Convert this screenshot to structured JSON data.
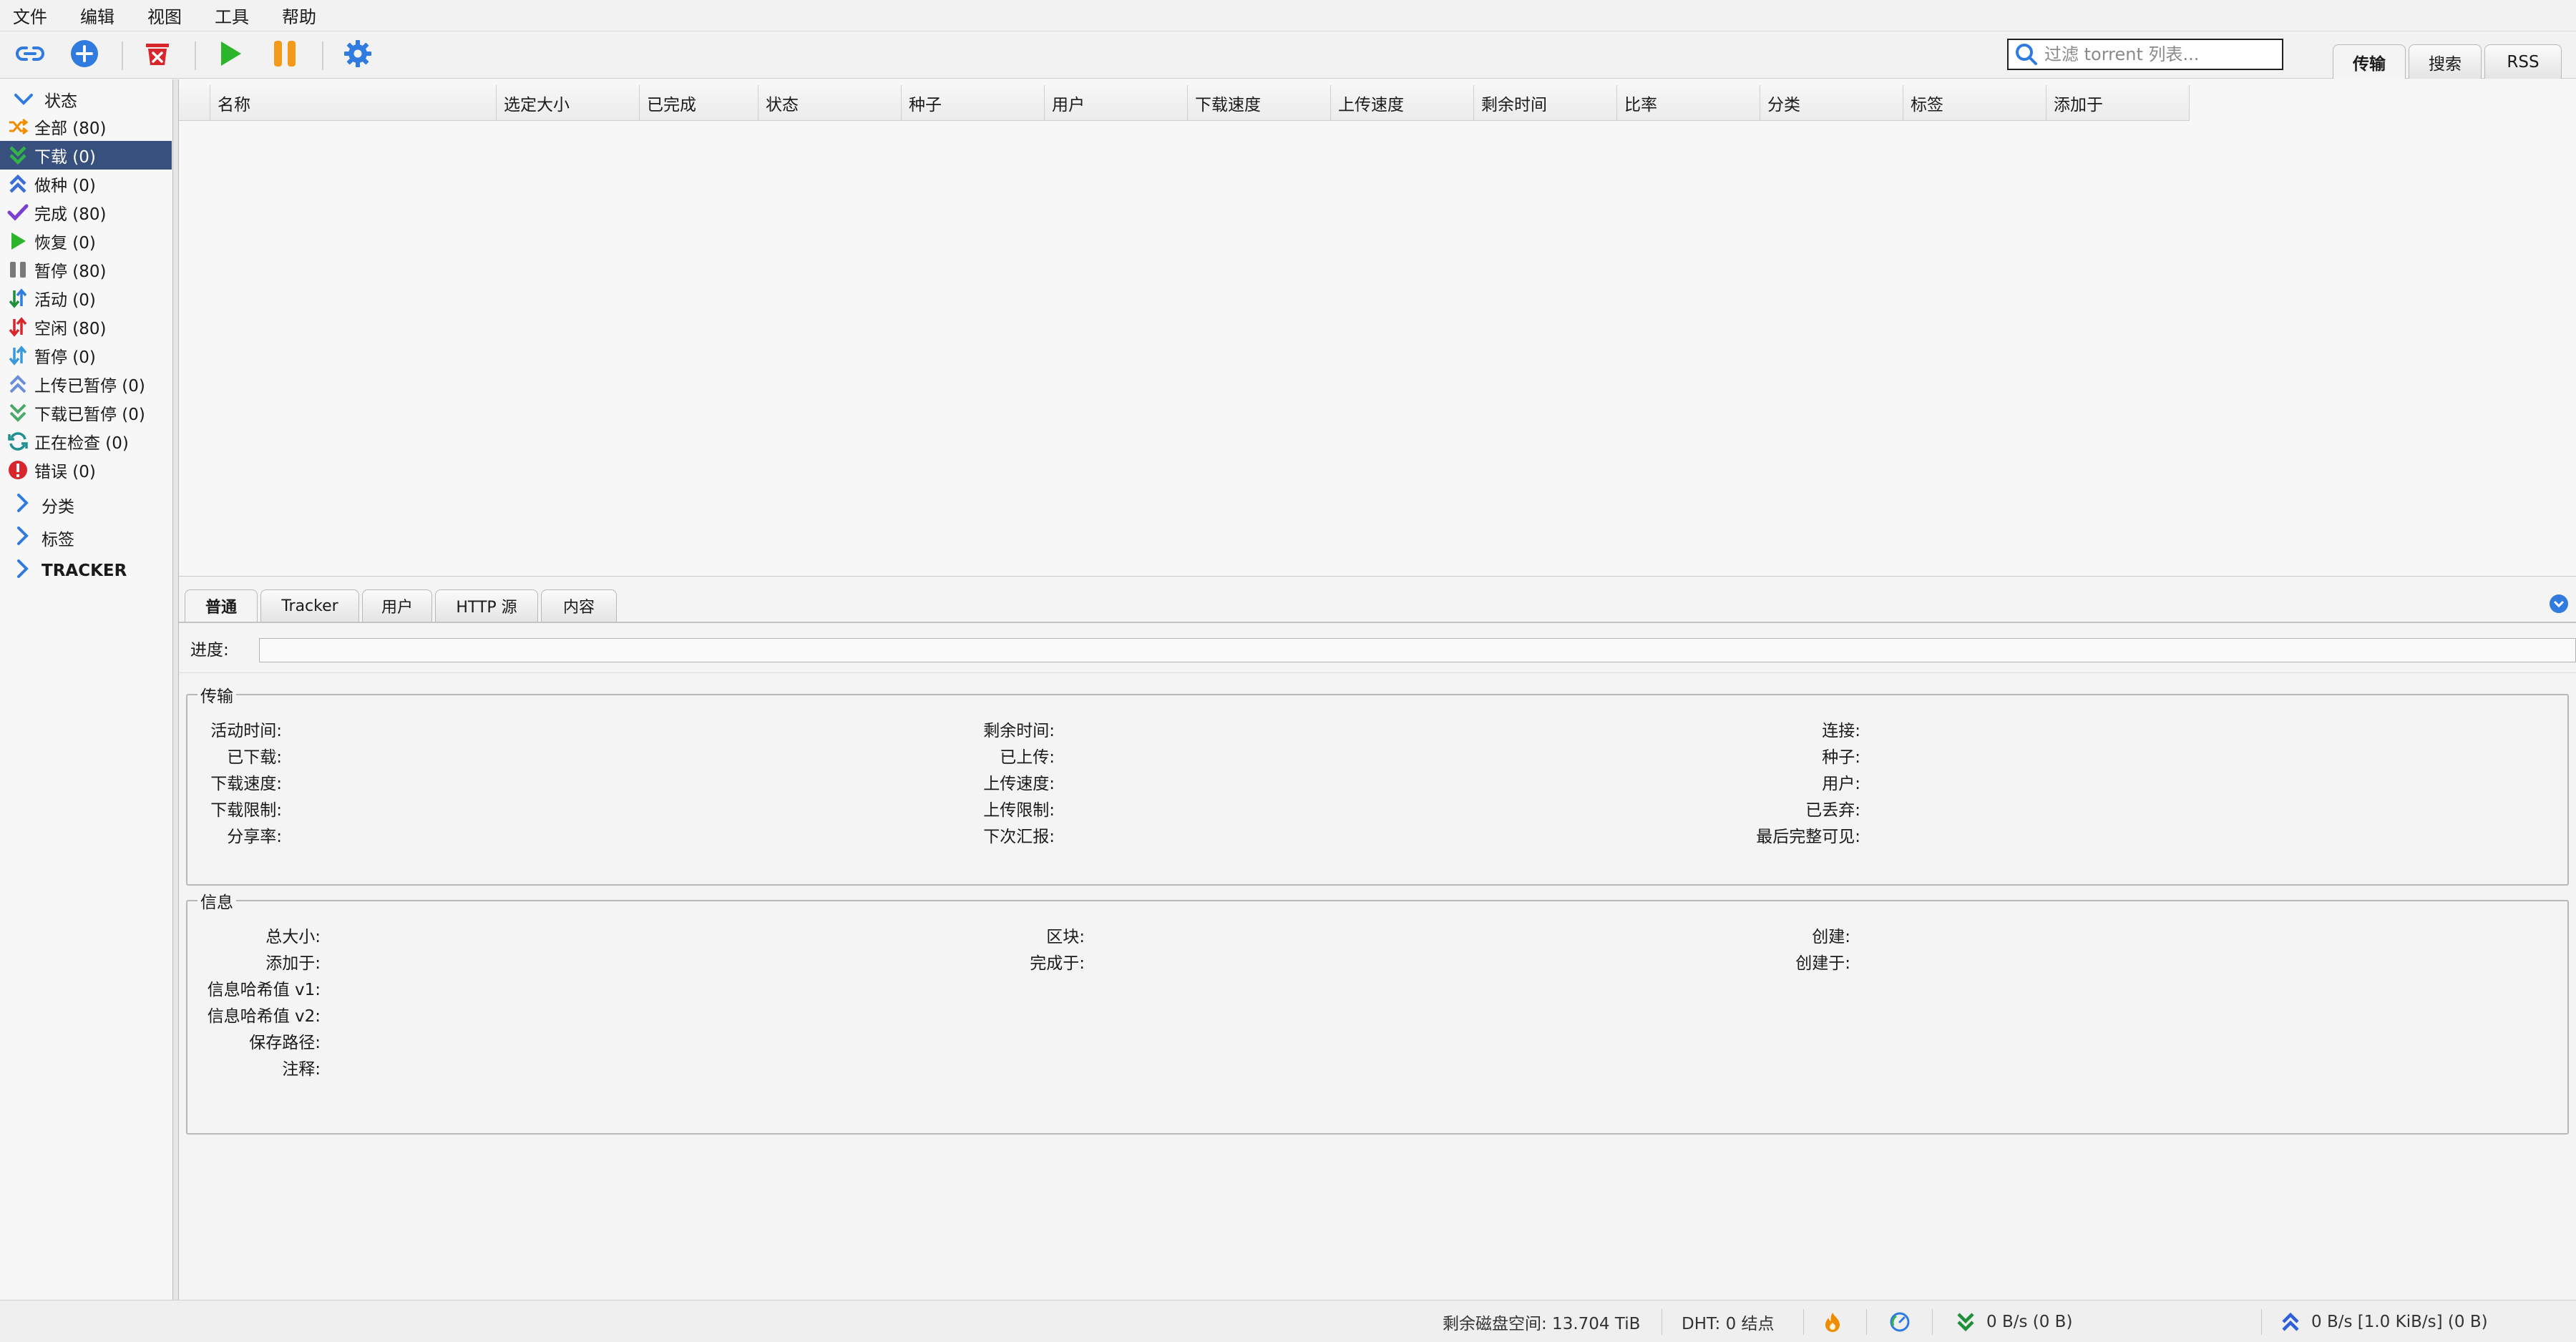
{
  "menu": [
    "文件",
    "编辑",
    "视图",
    "工具",
    "帮助"
  ],
  "toolbar": {
    "icons": [
      "add-link-icon",
      "add-torrent-icon",
      "delete-icon",
      "resume-icon",
      "pause-icon",
      "options-icon"
    ],
    "search_placeholder": "过滤 torrent 列表..."
  },
  "top_tabs": [
    "传输",
    "搜索",
    "RSS"
  ],
  "sidebar": {
    "status_header": "状态",
    "items": [
      {
        "label": "全部 (80)",
        "icon": "shuffle-icon",
        "color": "#f08c00"
      },
      {
        "label": "下载 (0)",
        "icon": "download-icon",
        "color": "#2e9e3e"
      },
      {
        "label": "做种 (0)",
        "icon": "seeding-icon",
        "color": "#3a6fd8"
      },
      {
        "label": "完成 (80)",
        "icon": "checkmark-icon",
        "color": "#7b3fd1"
      },
      {
        "label": "恢复 (0)",
        "icon": "play-icon",
        "color": "#2ab52a"
      },
      {
        "label": "暂停 (80)",
        "icon": "pause-icon",
        "color": "#7a7a7a"
      },
      {
        "label": "活动 (0)",
        "icon": "active-icon",
        "color": "#1f8f3a"
      },
      {
        "label": "空闲 (80)",
        "icon": "inactive-icon",
        "color": "#d8262c"
      },
      {
        "label": "暂停 (0)",
        "icon": "stalled-icon",
        "color": "#3a9ad9"
      },
      {
        "label": "上传已暂停 (0)",
        "icon": "stalled-upload-icon",
        "color": "#6a8fd8"
      },
      {
        "label": "下载已暂停 (0)",
        "icon": "stalled-download-icon",
        "color": "#4aa86a"
      },
      {
        "label": "正在检查 (0)",
        "icon": "checking-icon",
        "color": "#1f8f8f"
      },
      {
        "label": "错误 (0)",
        "icon": "error-icon",
        "color": "#d8262c"
      }
    ],
    "groups": [
      "分类",
      "标签",
      "TRACKER"
    ]
  },
  "columns": [
    "名称",
    "选定大小",
    "已完成",
    "状态",
    "种子",
    "用户",
    "下载速度",
    "上传速度",
    "剩余时间",
    "比率",
    "分类",
    "标签",
    "添加于"
  ],
  "props": {
    "tabs": [
      "普通",
      "Tracker",
      "用户",
      "HTTP 源",
      "内容"
    ],
    "progress_label": "进度:",
    "progress": 0,
    "transfer": {
      "title": "传输",
      "col1": [
        "活动时间:",
        "已下载:",
        "下载速度:",
        "下载限制:",
        "分享率:"
      ],
      "col2": [
        "剩余时间:",
        "已上传:",
        "上传速度:",
        "上传限制:",
        "下次汇报:"
      ],
      "col3": [
        "连接:",
        "种子:",
        "用户:",
        "已丢弃:",
        "最后完整可见:"
      ]
    },
    "info": {
      "title": "信息",
      "col1": [
        "总大小:",
        "添加于:",
        "信息哈希值 v1:",
        "信息哈希值 v2:",
        "保存路径:",
        "注释:"
      ],
      "col2": [
        "区块:",
        "完成于:"
      ],
      "col3": [
        "创建:",
        "创建于:"
      ]
    }
  },
  "status": {
    "disk": "剩余磁盘空间: 13.704 TiB",
    "dht": "DHT: 0 结点",
    "download": "0 B/s (0 B)",
    "upload": "0 B/s [1.0 KiB/s] (0 B)"
  },
  "colors": {
    "selected_row": "#37507e",
    "accent_blue": "#2f7be0",
    "play_green": "#2ab52a",
    "pause_orange": "#f39a1b",
    "delete_red": "#d8262c"
  }
}
